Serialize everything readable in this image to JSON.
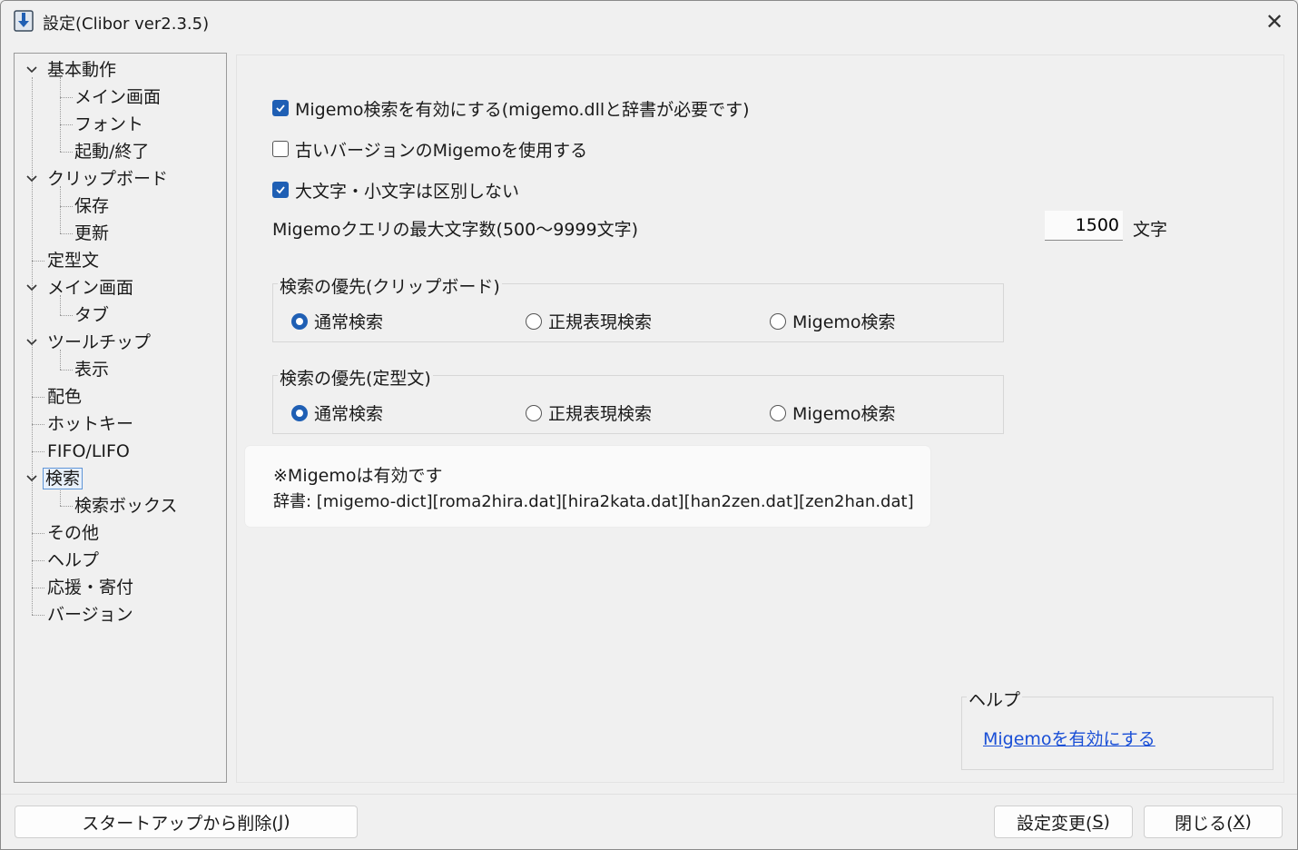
{
  "window": {
    "title": "設定(Clibor ver2.3.5)",
    "close": "✕"
  },
  "tree": {
    "items": [
      {
        "label": "基本動作"
      },
      {
        "label": "メイン画面"
      },
      {
        "label": "フォント"
      },
      {
        "label": "起動/終了"
      },
      {
        "label": "クリップボード"
      },
      {
        "label": "保存"
      },
      {
        "label": "更新"
      },
      {
        "label": "定型文"
      },
      {
        "label": "メイン画面"
      },
      {
        "label": "タブ"
      },
      {
        "label": "ツールチップ"
      },
      {
        "label": "表示"
      },
      {
        "label": "配色"
      },
      {
        "label": "ホットキー"
      },
      {
        "label": "FIFO/LIFO"
      },
      {
        "label": "検索"
      },
      {
        "label": "検索ボックス"
      },
      {
        "label": "その他"
      },
      {
        "label": "ヘルプ"
      },
      {
        "label": "応援・寄付"
      },
      {
        "label": "バージョン"
      }
    ]
  },
  "main": {
    "migemo_enable": {
      "label": "Migemo検索を有効にする(migemo.dllと辞書が必要です)",
      "checked": true
    },
    "old_migemo": {
      "label": "古いバージョンのMigemoを使用する",
      "checked": false
    },
    "ignore_case": {
      "label": "大文字・小文字は区別しない",
      "checked": true
    },
    "max_query": {
      "label": "Migemoクエリの最大文字数(500～9999文字)",
      "value": "1500",
      "unit": "文字"
    },
    "priority_clipboard": {
      "title": "検索の優先(クリップボード)",
      "options": [
        "通常検索",
        "正規表現検索",
        "Migemo検索"
      ],
      "selected": 0
    },
    "priority_template": {
      "title": "検索の優先(定型文)",
      "options": [
        "通常検索",
        "正規表現検索",
        "Migemo検索"
      ],
      "selected": 0
    },
    "info": {
      "line1": "※Migemoは有効です",
      "line2": "辞書: [migemo-dict][roma2hira.dat][hira2kata.dat][han2zen.dat][zen2han.dat]"
    },
    "help": {
      "title": "ヘルプ",
      "link": "Migemoを有効にする"
    }
  },
  "footer": {
    "remove_startup": {
      "text": "スタートアップから削除(",
      "key": "J",
      "end": ")"
    },
    "apply": {
      "text": "設定変更(",
      "key": "S",
      "end": ")"
    },
    "close": {
      "text": "閉じる(",
      "key": "X",
      "end": ")"
    }
  },
  "colors": {
    "accent": "#1f5fb4",
    "link": "#1a4fd6"
  }
}
